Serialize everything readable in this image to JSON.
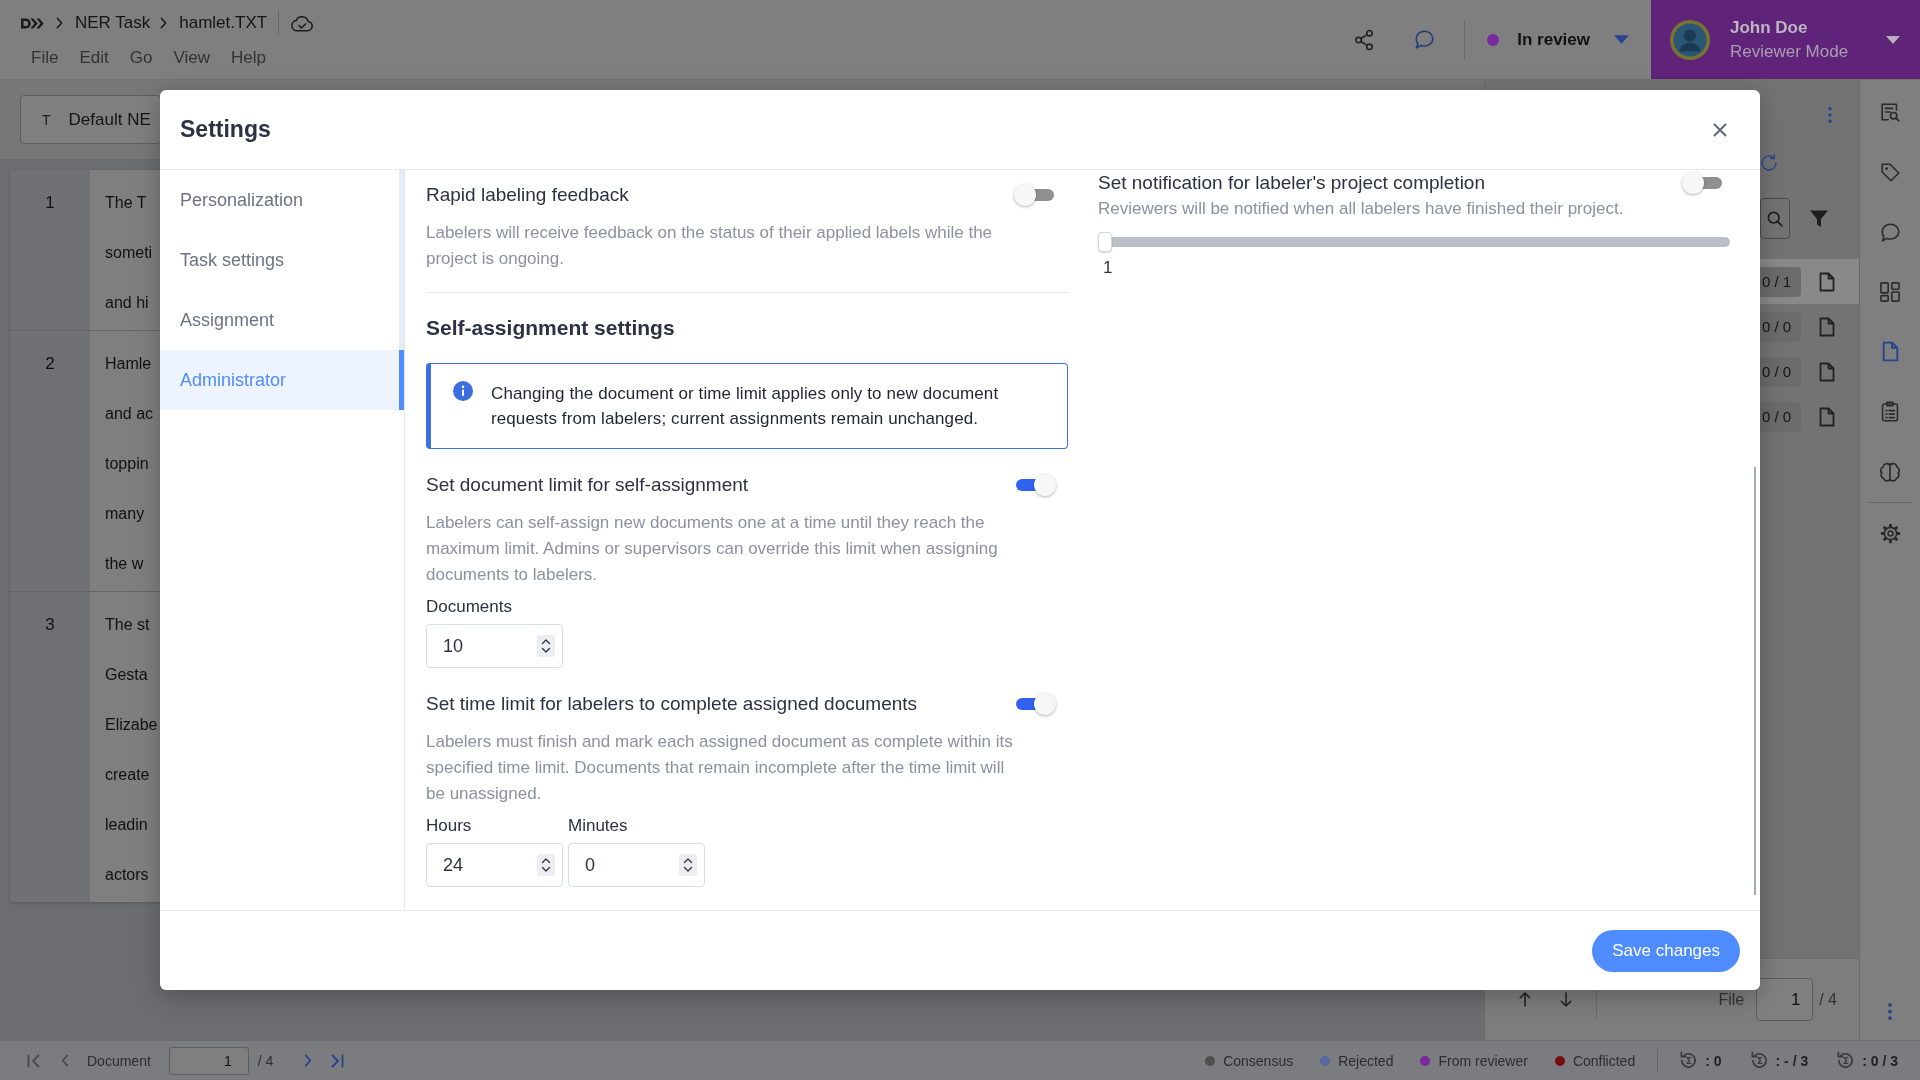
{
  "header": {
    "breadcrumb": [
      "NER Task",
      "hamlet.TXT"
    ],
    "menu": [
      "File",
      "Edit",
      "Go",
      "View",
      "Help"
    ],
    "review_status": "In review",
    "user": {
      "name": "John Doe",
      "mode": "Reviewer Mode"
    }
  },
  "label_set": {
    "glyph": "T",
    "value": "Default NE"
  },
  "document": {
    "rows": [
      {
        "number": "1",
        "lines": [
          "The T",
          "someti",
          "and hi"
        ]
      },
      {
        "number": "2",
        "lines": [
          "Hamle",
          "and ac",
          "toppin",
          "many",
          "the w"
        ]
      },
      {
        "number": "3",
        "lines": [
          "The st",
          "Gesta",
          "Elizabe",
          "create",
          "leadin",
          "actors"
        ]
      }
    ]
  },
  "side_panel": {
    "files": [
      {
        "count": "0 / 1",
        "selected": true
      },
      {
        "count": "0 / 0",
        "selected": false
      },
      {
        "count": "0 / 0",
        "selected": false
      },
      {
        "count": "0 / 0",
        "selected": false
      }
    ],
    "file_nav": {
      "label": "File",
      "value": "1",
      "total": "/ 4"
    }
  },
  "tool_rail": [
    {
      "selected": false
    },
    {
      "selected": false
    },
    {
      "selected": false
    },
    {
      "selected": false
    },
    {
      "selected": true
    },
    {
      "selected": false
    },
    {
      "selected": false
    },
    {
      "selected": false
    }
  ],
  "status_bar": {
    "document_label": "Document",
    "page": "1",
    "total": "/ 4",
    "legend": [
      {
        "label": "Consensus",
        "color": "#4f4f4f"
      },
      {
        "label": "Rejected",
        "color": "#56689e"
      },
      {
        "label": "From reviewer",
        "color": "#782a98"
      },
      {
        "label": "Conflicted",
        "color": "#760c10"
      }
    ],
    "stats": [
      ": 0",
      ": - / 3",
      ": 0 / 3"
    ]
  },
  "settings": {
    "title": "Settings",
    "nav": [
      {
        "label": "Personalization",
        "selected": false
      },
      {
        "label": "Task settings",
        "selected": false
      },
      {
        "label": "Assignment",
        "selected": false
      },
      {
        "label": "Administrator",
        "selected": true
      }
    ],
    "groups": [
      {
        "settings": [
          {
            "title": "Rapid labeling feedback",
            "on": false,
            "description": "Labelers will receive feedback on the status of their applied labels while the project is ongoing."
          }
        ]
      },
      {
        "heading": "Self-assignment settings",
        "notice": "Changing the document or time limit applies only to new document requests from labelers; current assignments remain unchanged.",
        "settings": [
          {
            "title": "Set document limit for self-assignment",
            "on": true,
            "description": "Labelers can self-assign new documents one at a time until they reach the maximum limit. Admins or supervisors can override this limit when assigning documents to labelers.",
            "fields": [
              {
                "label": "Documents",
                "value": "10"
              }
            ]
          },
          {
            "title": "Set time limit for labelers to complete assigned documents",
            "on": true,
            "description": "Labelers must finish and mark each assigned document as complete within its specified time limit. Documents that remain incomplete after the time limit will be unassigned.",
            "fields": [
              {
                "label": "Hours",
                "value": "24"
              },
              {
                "label": "Minutes",
                "value": "0"
              }
            ]
          }
        ]
      }
    ],
    "side_setting": {
      "title": "Set notification for labeler's project completion",
      "on": false,
      "description": "Reviewers will be notified when all labelers have finished their project.",
      "slider": {
        "level": 0,
        "reading": "1"
      }
    },
    "save_button": "Save changes"
  }
}
